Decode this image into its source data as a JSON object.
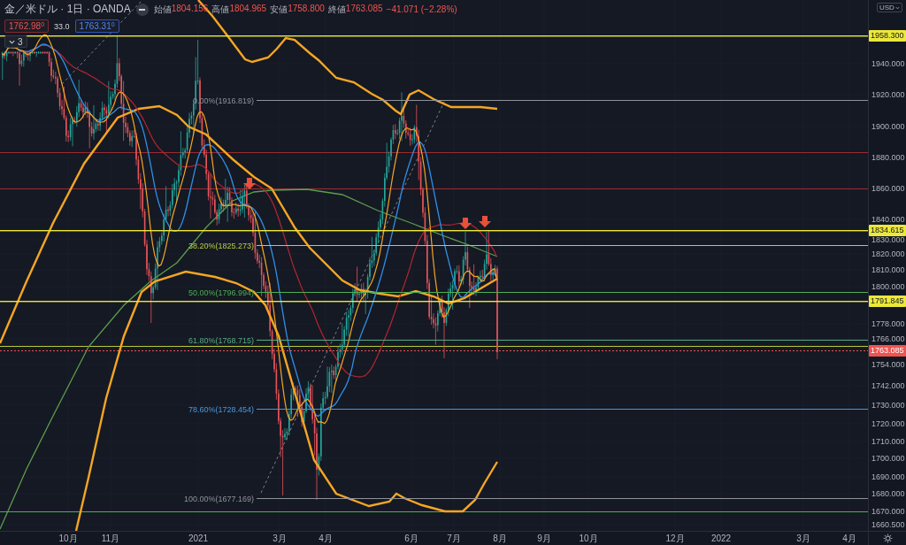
{
  "header": {
    "title": "金／米ドル · 1日 · OANDA",
    "ohlc": [
      {
        "label": "始値",
        "value": "1804.156"
      },
      {
        "label": "高値",
        "value": "1804.965"
      },
      {
        "label": "安値",
        "value": "1758.800"
      },
      {
        "label": "終値",
        "value": "1763.085"
      }
    ],
    "change": "−41.071 (−2.28%)"
  },
  "trade": {
    "sell": "1762.98$^{0}$",
    "spread": "33.0",
    "buy": "1763.31$^{0}$"
  },
  "indicators": {
    "count": "3"
  },
  "fibonacci": [
    {
      "label": "0.00%(1916.819)",
      "color": "#8f929b"
    },
    {
      "label": "38.20%(1825.273)",
      "color": "#b8cf45"
    },
    {
      "label": "50.00%(1796.994)",
      "color": "#4caf50"
    },
    {
      "label": "61.80%(1768.715)",
      "color": "#55a985"
    },
    {
      "label": "78.60%(1728.454)",
      "color": "#4a97dc"
    },
    {
      "label": "100.00%(1677.169)",
      "color": "#8f929b"
    }
  ],
  "price_axis": {
    "currency": "USD",
    "labels": [
      "1940.000",
      "1920.000",
      "1900.000",
      "1880.000",
      "1860.000",
      "1840.000",
      "1830.000",
      "1820.000",
      "1810.000",
      "1800.000",
      "1778.000",
      "1766.000",
      "1754.000",
      "1742.000",
      "1730.000",
      "1720.000",
      "1710.000",
      "1700.000",
      "1690.000",
      "1680.000",
      "1670.000",
      "1660.500"
    ],
    "badges": [
      {
        "text": "1958.300",
        "kind": "level"
      },
      {
        "text": "1834.615",
        "kind": "level"
      },
      {
        "text": "1791.845",
        "kind": "level"
      },
      {
        "text": "1763.085",
        "kind": "last_price"
      }
    ]
  },
  "time_axis": {
    "labels": [
      "10月",
      "11月",
      "2021",
      "3月",
      "4月",
      "6月",
      "7月",
      "8月",
      "9月",
      "10月",
      "12月",
      "2022",
      "3月",
      "4月"
    ]
  }
}
